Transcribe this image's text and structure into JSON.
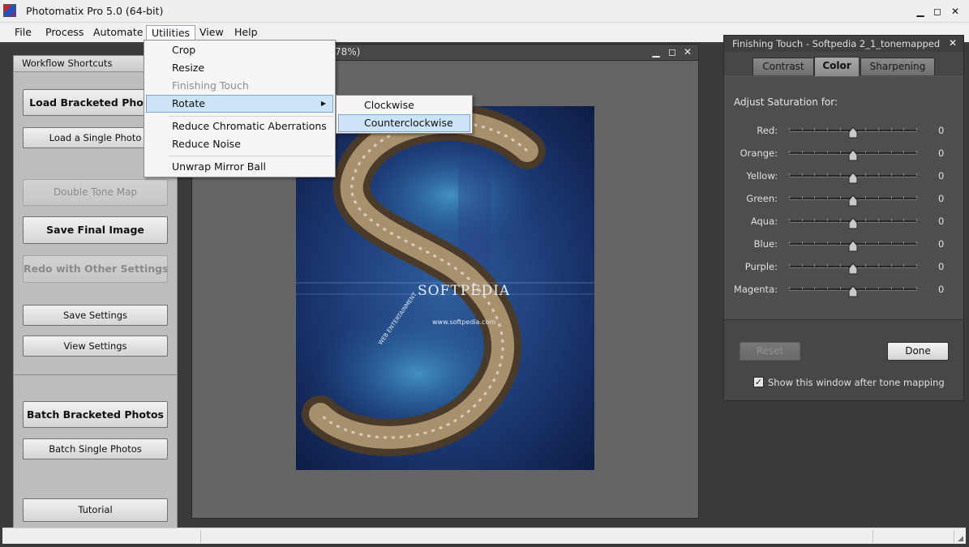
{
  "window": {
    "title": "Photomatix Pro 5.0 (64-bit)",
    "controls": [
      "minimize",
      "maximize",
      "close"
    ]
  },
  "menubar": {
    "items": [
      {
        "label": "File"
      },
      {
        "label": "Process"
      },
      {
        "label": "Automate"
      },
      {
        "label": "Utilities",
        "open": true
      },
      {
        "label": "View"
      },
      {
        "label": "Help"
      }
    ]
  },
  "utilities_menu": {
    "items": [
      {
        "label": "Crop"
      },
      {
        "label": "Resize"
      },
      {
        "label": "Finishing Touch",
        "disabled": true
      },
      {
        "label": "Rotate",
        "highlighted": true,
        "has_submenu": true
      },
      {
        "label": "Reduce Chromatic Aberrations"
      },
      {
        "label": "Reduce Noise"
      },
      {
        "label": "Unwrap Mirror Ball"
      }
    ]
  },
  "rotate_submenu": {
    "items": [
      {
        "label": "Clockwise"
      },
      {
        "label": "Counterclockwise",
        "highlighted": true
      }
    ]
  },
  "workflow": {
    "header": "Workflow Shortcuts",
    "buttons": {
      "load_bracketed": "Load Bracketed Photos",
      "load_single": "Load a Single Photo",
      "double_tone_map": "Double Tone Map",
      "save_final": "Save Final Image",
      "redo": "Redo with Other Settings",
      "save_settings": "Save Settings",
      "view_settings": "View Settings",
      "batch_bracketed": "Batch Bracketed Photos",
      "batch_single": "Batch Single Photos",
      "tutorial": "Tutorial"
    }
  },
  "image_window": {
    "title_visible": "78%)",
    "photo": {
      "watermark": "SOFTPEDIA",
      "url": "www.softpedia.com",
      "caption": "WEB ENTERTAINMENT"
    }
  },
  "finishing_touch": {
    "title": "Finishing Touch - Softpedia 2_1_tonemapped",
    "tabs": [
      {
        "label": "Contrast"
      },
      {
        "label": "Color",
        "active": true
      },
      {
        "label": "Sharpening"
      }
    ],
    "heading": "Adjust Saturation for:",
    "sliders": [
      {
        "label": "Red:",
        "value": "0"
      },
      {
        "label": "Orange:",
        "value": "0"
      },
      {
        "label": "Yellow:",
        "value": "0"
      },
      {
        "label": "Green:",
        "value": "0"
      },
      {
        "label": "Aqua:",
        "value": "0"
      },
      {
        "label": "Blue:",
        "value": "0"
      },
      {
        "label": "Purple:",
        "value": "0"
      },
      {
        "label": "Magenta:",
        "value": "0"
      }
    ],
    "slider_level": 0.5,
    "reset_label": "Reset",
    "done_label": "Done",
    "checkbox_label": "Show this window after tone mapping",
    "checkbox_checked": true
  },
  "colors": {
    "menu_highlight": "#cde3f8",
    "panel_dark": "#474747",
    "workflow_bg": "#bdbdbd"
  }
}
